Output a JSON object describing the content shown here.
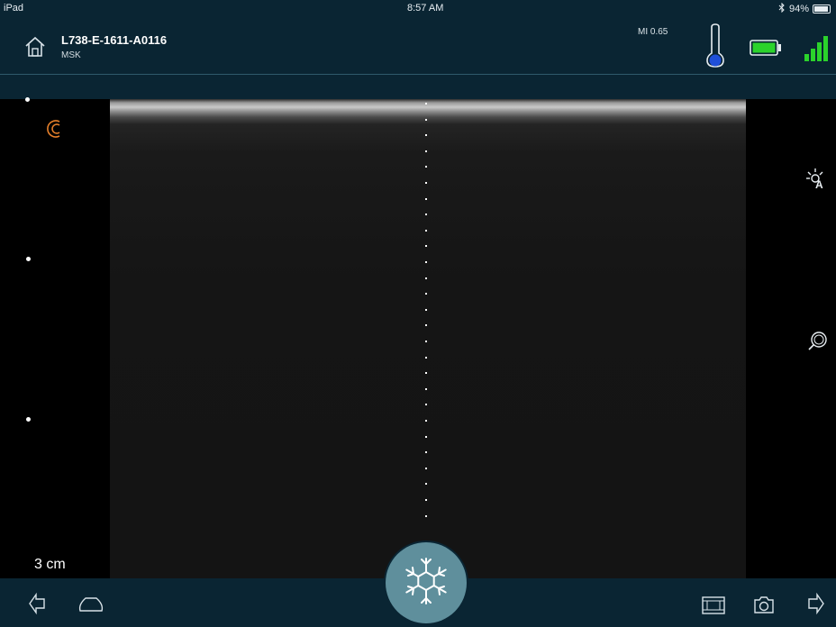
{
  "status_bar": {
    "carrier": "iPad",
    "time": "8:57 AM",
    "bluetooth_icon": "bluetooth-icon",
    "battery_percent": "94%",
    "battery_level": 0.94
  },
  "header": {
    "home_icon": "home-icon",
    "probe_id": "L738-E-1611-A0116",
    "preset": "MSK",
    "mi_label": "MI 0.65",
    "temperature_icon": "thermometer-icon",
    "battery_icon": "battery-icon",
    "signal_icon": "signal-bars-icon",
    "colors": {
      "bar_bg": "#0a2533",
      "battery": "#2bd32b",
      "signal": "#2bd32b",
      "thermometer": "#1f4fd8",
      "probe_mark": "#e57f2a"
    }
  },
  "image_area": {
    "depth_label": "3 cm",
    "probe_orientation_icon": "probe-orientation-icon",
    "auto_gain_icon": "auto-gain-icon",
    "zoom_icon": "zoom-icon"
  },
  "bottom_bar": {
    "back_icon": "back-arrow-icon",
    "probe_shape_icon": "probe-footprint-icon",
    "freeze_icon": "snowflake-icon",
    "cine_icon": "film-strip-icon",
    "capture_icon": "camera-icon",
    "forward_icon": "forward-arrow-icon",
    "freeze_color": "#5f8f9c"
  }
}
